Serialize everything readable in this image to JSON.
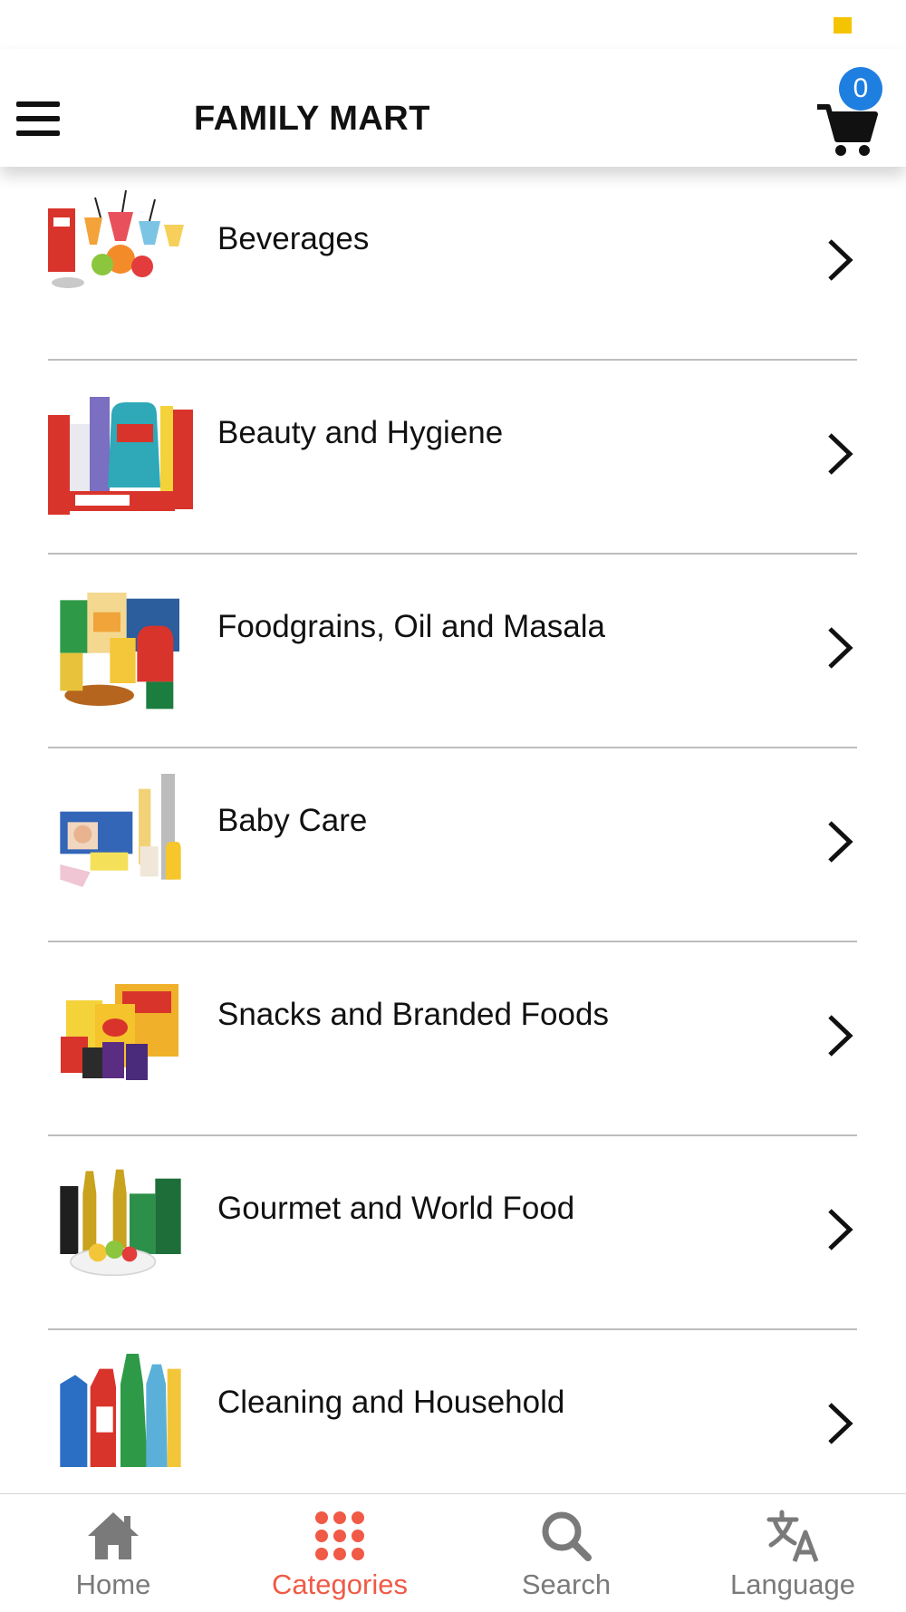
{
  "header": {
    "title": "FAMILY MART",
    "cart_count": "0"
  },
  "categories": [
    {
      "label": "Beverages",
      "thumb": "beverages-image"
    },
    {
      "label": "Beauty and Hygiene",
      "thumb": "beauty-hygiene-image"
    },
    {
      "label": "Foodgrains, Oil and Masala",
      "thumb": "foodgrains-image"
    },
    {
      "label": "Baby Care",
      "thumb": "baby-care-image"
    },
    {
      "label": "Snacks and Branded Foods",
      "thumb": "snacks-image"
    },
    {
      "label": "Gourmet and World Food",
      "thumb": "gourmet-image"
    },
    {
      "label": "Cleaning and Household",
      "thumb": "cleaning-image"
    }
  ],
  "tabs": [
    {
      "label": "Home",
      "icon": "home-icon",
      "active": false
    },
    {
      "label": "Categories",
      "icon": "grid-dots-icon",
      "active": true
    },
    {
      "label": "Search",
      "icon": "search-icon",
      "active": false
    },
    {
      "label": "Language",
      "icon": "translate-icon",
      "active": false
    }
  ],
  "colors": {
    "accent": "#f05a46",
    "badge": "#1f7fe0",
    "status_indicator": "#f5c400",
    "inactive_tab": "#7a7a7a"
  }
}
